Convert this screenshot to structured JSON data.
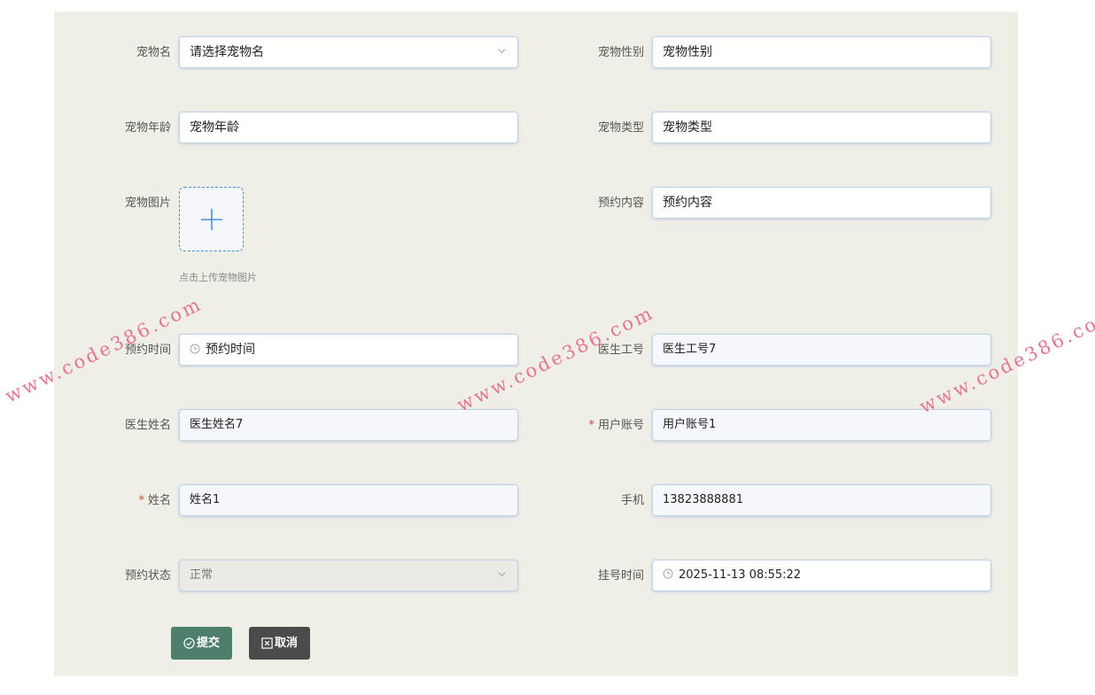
{
  "form": {
    "pet_name": {
      "label": "宠物名",
      "value": "请选择宠物名"
    },
    "pet_gender": {
      "label": "宠物性别",
      "value": "宠物性别"
    },
    "pet_age": {
      "label": "宠物年龄",
      "value": "宠物年龄"
    },
    "pet_type": {
      "label": "宠物类型",
      "value": "宠物类型"
    },
    "pet_image": {
      "label": "宠物图片",
      "hint": "点击上传宠物图片"
    },
    "appointment_content": {
      "label": "预约内容",
      "value": "预约内容"
    },
    "appointment_time": {
      "label": "预约时间",
      "value": "预约时间"
    },
    "doctor_id": {
      "label": "医生工号",
      "value": "医生工号7"
    },
    "doctor_name": {
      "label": "医生姓名",
      "value": "医生姓名7"
    },
    "user_account": {
      "label": "用户账号",
      "value": "用户账号1",
      "required": "*"
    },
    "name": {
      "label": "姓名",
      "value": "姓名1",
      "required": "*"
    },
    "phone": {
      "label": "手机",
      "value": "13823888881"
    },
    "appointment_status": {
      "label": "预约状态",
      "value": "正常"
    },
    "registration_time": {
      "label": "挂号时间",
      "value": "2025-11-13 08:55:22"
    }
  },
  "buttons": {
    "submit": "提交",
    "cancel": "取消"
  },
  "watermark": "www.code386.com",
  "colors": {
    "panel_bg": "#f0efe7",
    "submit_button": "#4e7e6c",
    "cancel_button": "#4b4b4b",
    "input_border": "#bcd3ee",
    "required_mark": "#d14a3a",
    "watermark": "#e16b86"
  },
  "icons": {
    "select": "chevron-down-icon",
    "time": "clock-icon",
    "upload": "plus-icon",
    "submit": "check-circle-icon",
    "cancel": "close-square-icon"
  }
}
